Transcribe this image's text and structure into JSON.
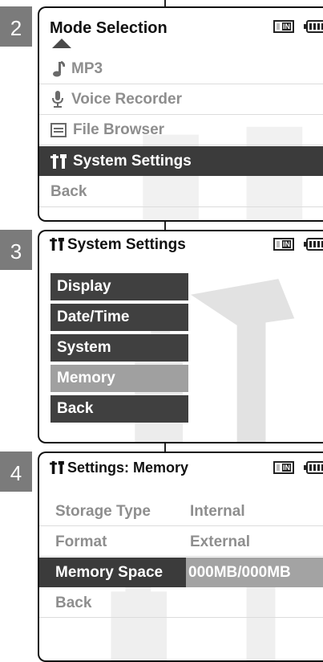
{
  "step2": {
    "number": "2",
    "title": "Mode Selection",
    "indicator_text": "IN",
    "items": [
      {
        "icon": "music-note-icon",
        "label": "MP3"
      },
      {
        "icon": "microphone-icon",
        "label": "Voice Recorder"
      },
      {
        "icon": "document-icon",
        "label": "File Browser"
      },
      {
        "icon": "tools-icon",
        "label": "System Settings"
      },
      {
        "label": "Back"
      }
    ],
    "selected_index": 3
  },
  "step3": {
    "number": "3",
    "title": "System Settings",
    "indicator_text": "IN",
    "buttons": [
      "Display",
      "Date/Time",
      "System",
      "Memory",
      "Back"
    ],
    "highlighted_index": 3
  },
  "step4": {
    "number": "4",
    "title": "Settings: Memory",
    "indicator_text": "IN",
    "rows": [
      {
        "key": "Storage Type",
        "value": "Internal"
      },
      {
        "key": "Format",
        "value": "External"
      },
      {
        "key": "Memory Space",
        "value": "000MB/000MB"
      },
      {
        "key": "Back",
        "value": ""
      }
    ],
    "selected_index": 2
  },
  "colors": {
    "selected_bg": "#3b3b3b",
    "button_bg": "#404040",
    "highlight": "#a0a0a0",
    "muted_text": "#8e8e8e"
  }
}
